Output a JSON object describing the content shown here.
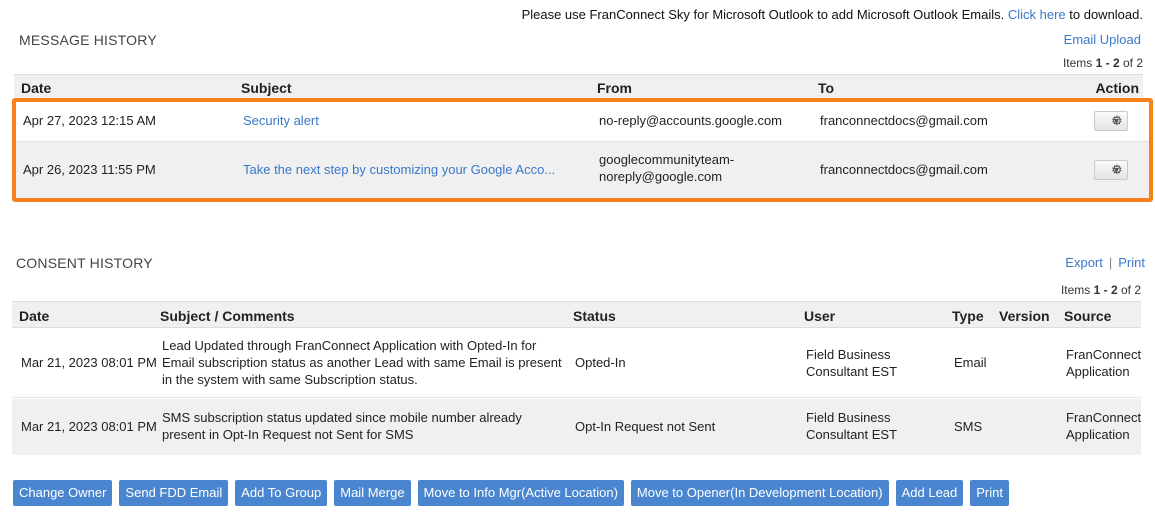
{
  "notice": {
    "text": "Please use FranConnect Sky for Microsoft Outlook to add Microsoft Outlook Emails.",
    "link": "Click here",
    "suffix": "to download."
  },
  "message_history": {
    "title": "MESSAGE HISTORY",
    "email_upload": "Email Upload",
    "items_label": "Items",
    "items_range": "1 - 2",
    "items_of": "of 2",
    "columns": [
      "Date",
      "Subject",
      "From",
      "To",
      "Action"
    ],
    "rows": [
      {
        "date": "Apr 27, 2023 12:15 AM",
        "subject": "Security alert",
        "from": "no-reply@accounts.google.com",
        "from_line2": "",
        "to": "franconnectdocs@gmail.com"
      },
      {
        "date": "Apr 26, 2023 11:55 PM",
        "subject": "Take the next step by customizing your Google Acco...",
        "from": "googlecommunityteam-",
        "from_line2": "noreply@google.com",
        "to": "franconnectdocs@gmail.com"
      }
    ],
    "action_icon": "gear-icon"
  },
  "consent_history": {
    "title": "CONSENT HISTORY",
    "export": "Export",
    "print": "Print",
    "items_label": "Items",
    "items_range": "1 - 2",
    "items_of": "of 2",
    "columns": [
      "Date",
      "Subject / Comments",
      "Status",
      "User",
      "Type",
      "Version",
      "Source"
    ],
    "rows": [
      {
        "date": "Mar 21, 2023 08:01 PM",
        "comment_l1": "Lead Updated through FranConnect Application with Opted-In for",
        "comment_l2": "Email subscription status as another Lead with same Email is present",
        "comment_l3": "in the system with same Subscription status.",
        "status": "Opted-In",
        "user_l1": "Field Business",
        "user_l2": "Consultant EST",
        "type": "Email",
        "version": "",
        "source_l1": "FranConnect",
        "source_l2": "Application"
      },
      {
        "date": "Mar 21, 2023 08:01 PM",
        "comment_l1": "SMS subscription status updated since mobile number already",
        "comment_l2": "present in Opt-In Request not Sent for SMS",
        "comment_l3": "",
        "status": "Opt-In Request not Sent",
        "user_l1": "Field Business",
        "user_l2": "Consultant EST",
        "type": "SMS",
        "version": "",
        "source_l1": "FranConnect",
        "source_l2": "Application"
      }
    ]
  },
  "actions": [
    "Change Owner",
    "Send FDD Email",
    "Add To Group",
    "Mail Merge",
    "Move to Info Mgr(Active Location)",
    "Move to Opener(In Development Location)",
    "Add Lead",
    "Print"
  ],
  "colors": {
    "link": "#3a78c9",
    "button": "#4a86cf",
    "highlight": "#f7821b",
    "header_bg": "#f0f0f0"
  }
}
